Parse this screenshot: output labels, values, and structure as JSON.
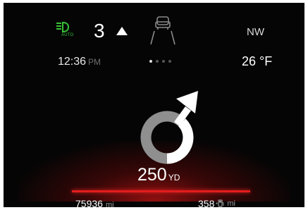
{
  "status_bar": {
    "headlight_mode_label": "AUTO",
    "gear_number": "3",
    "heading": "NW"
  },
  "info_row": {
    "time": "12:36",
    "time_period": "PM",
    "temperature": "26 °F"
  },
  "pager": {
    "total_pages": 4,
    "active_page": 1
  },
  "navigation": {
    "distance_value": "250",
    "distance_unit": "YD"
  },
  "trip": {
    "odometer_value": "75936",
    "odometer_unit": "mi",
    "range_value": "358",
    "range_unit": "mi"
  },
  "icons": {
    "headlamp": "headlamp-auto-icon",
    "gear_up": "gear-up-arrow-icon",
    "lane": "lane-sense-car-icon",
    "maneuver": "roundabout-turn-icon",
    "fuel": "fuel-pump-icon"
  },
  "colors": {
    "headlamp_green": "#38c238",
    "accent_red": "#e21d1d",
    "background": "#050505",
    "muted_text": "#9a9a9a"
  }
}
